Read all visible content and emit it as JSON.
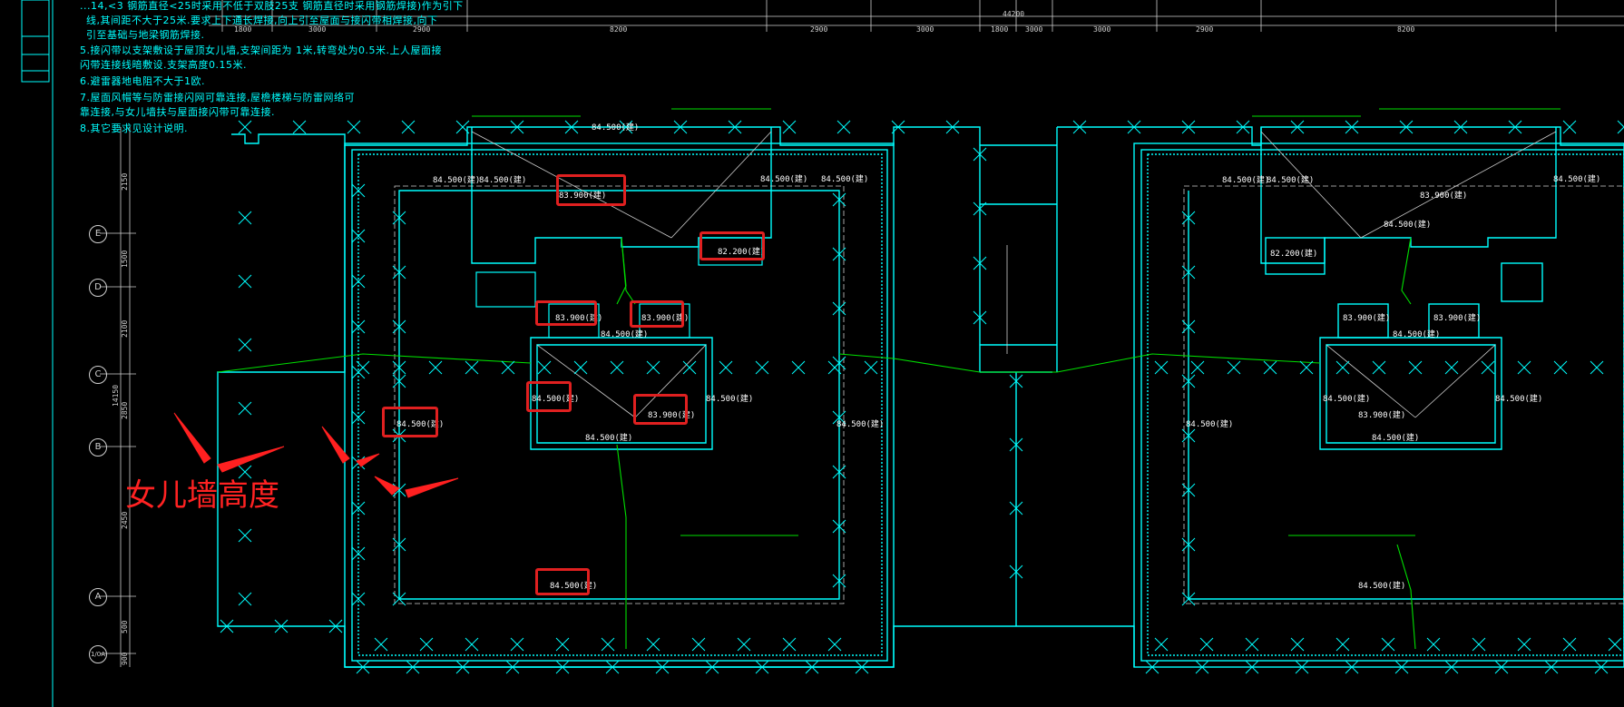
{
  "notes": [
    "5.接闪带以支架敷设于屋顶女儿墙,支架间距为 1米,转弯处为0.5米.上人屋面接",
    "   闪带连接线暗敷设.支架高度0.15米.",
    "6.避雷器地电阻不大于1欧.",
    "7.屋面风帽等与防雷接闪网可靠连接,屋檐楼梯与防雷网络可",
    "   靠连接,与女儿墙扶与屋面接闪带可靠连接.",
    "8.其它要求见设计说明."
  ],
  "top_notes_partial": [
    "...14,<3 钢筋直径<25时采用不低于双肢25支 钢筋直径时采用钢筋焊接)作为引下",
    "线,其间距不大于25米.要求上下通长焊接,向上引至屋面与接闪带相焊接,向下",
    "引至基础与地梁钢筋焊接."
  ],
  "axes": [
    "E",
    "D",
    "C",
    "B",
    "A",
    "1/0A"
  ],
  "top_dims": [
    "1800",
    "3000",
    "2900",
    "8200",
    "2900",
    "3000",
    "1800",
    "3000",
    "3000",
    "2900",
    "8200"
  ],
  "top_total": "44200",
  "left_dims": [
    "2150",
    "1500",
    "2100",
    "2850",
    "2450",
    "3100",
    "14150",
    "500",
    "900"
  ],
  "annotation": "女儿墙高度",
  "elevations": {
    "e1": "84.500(建)",
    "e2": "83.900(建)",
    "e3": "84.500(建)",
    "e4": "82.200(建)",
    "e5": "83.900(建)",
    "e6": "83.900(建)",
    "e7": "84.500(建)",
    "e8": "84.500(建)",
    "e9": "83.900(建)",
    "e10": "84.500(建)",
    "e11": "84.500(建)",
    "e12": "84.500(建)",
    "e13": "84.500(建)",
    "e14": "84.500(建)",
    "r1": "84.500(建)",
    "r2": "83.900(建)",
    "r3": "84.500(建)",
    "r4": "82.200(建)",
    "r5": "83.900(建)",
    "r6": "83.900(建)",
    "r7": "84.500(建)",
    "r8": "83.900(建)",
    "r9": "84.500(建)",
    "r10": "84.500(建)",
    "r11": "84.500(建)",
    "r12": "84.500(建)",
    "r13": "84.500(建)",
    "r14": "84.500(建)"
  },
  "colors": {
    "cyan": "#00ffff",
    "green": "#00e000",
    "white": "#ffffff",
    "red": "#e02020"
  }
}
